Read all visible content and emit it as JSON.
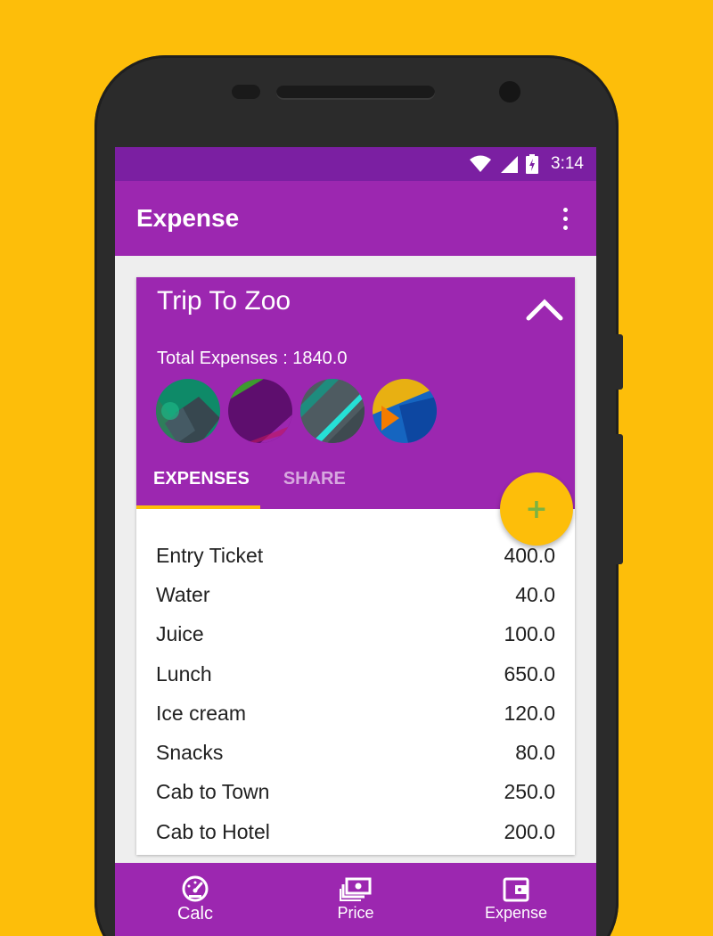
{
  "status_bar": {
    "time": "3:14"
  },
  "app_bar": {
    "title": "Expense"
  },
  "trip": {
    "title": "Trip To Zoo",
    "total_label": "Total Expenses : 1840.0"
  },
  "tabs": [
    {
      "label": "EXPENSES",
      "active": true
    },
    {
      "label": "SHARE",
      "active": false
    }
  ],
  "fab": {
    "label": "+"
  },
  "expenses": [
    {
      "name": "Entry Ticket",
      "amount": "400.0"
    },
    {
      "name": "Water",
      "amount": "40.0"
    },
    {
      "name": "Juice",
      "amount": "100.0"
    },
    {
      "name": "Lunch",
      "amount": "650.0"
    },
    {
      "name": "Ice cream",
      "amount": "120.0"
    },
    {
      "name": "Snacks",
      "amount": "80.0"
    },
    {
      "name": "Cab to Town",
      "amount": "250.0"
    },
    {
      "name": "Cab to Hotel",
      "amount": "200.0"
    }
  ],
  "bottom_nav": [
    {
      "label": "Calc",
      "icon": "speedometer-icon"
    },
    {
      "label": "Price",
      "icon": "money-stack-icon"
    },
    {
      "label": "Expense",
      "icon": "wallet-icon"
    }
  ],
  "colors": {
    "background": "#FDBE0A",
    "primary": "#9C27B0",
    "primary_dark": "#7B1FA2",
    "accent": "#FDBE0A"
  }
}
